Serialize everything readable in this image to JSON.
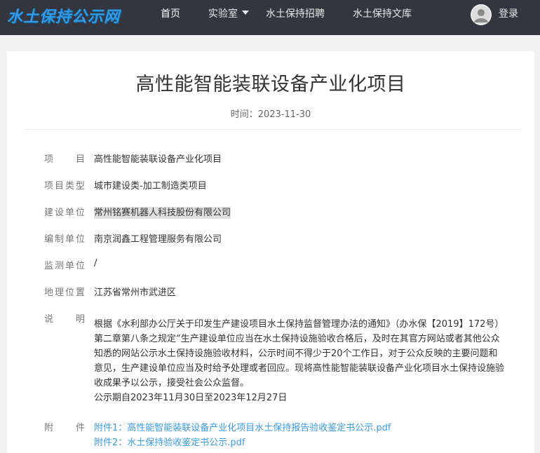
{
  "nav": {
    "logo": "水土保持公示网",
    "items": [
      "首页",
      "实验室",
      "水土保持招聘",
      "水土保持文库"
    ],
    "login": "登录",
    "icons": {
      "dropdown": "caret-down-icon",
      "avatar": "user-avatar-icon"
    },
    "colors": {
      "bar": "#33363f",
      "logo": "#2e9be8"
    }
  },
  "article": {
    "title": "高性能智能装联设备产业化项目",
    "time": "时间：2023-11-30",
    "fields": [
      {
        "label": "项目",
        "value": "高性能智能装联设备产业化项目"
      },
      {
        "label": "项目类型",
        "value": "城市建设类-加工制造类项目"
      },
      {
        "label": "建设单位",
        "value": "常州铭赛机器人科技股份有限公司"
      },
      {
        "label": "编制单位",
        "value": "南京润鑫工程管理服务有限公司"
      },
      {
        "label": "监测单位",
        "value": "/"
      },
      {
        "label": "地理位置",
        "value": "江苏省常州市武进区"
      }
    ],
    "desc_label": "说明",
    "desc": "根据《水利部办公厅关于印发生产建设项目水土保持监督管理办法的通知》（办水保【2019】172号）第二章第八条之规定“生产建设单位应当在水土保持设施验收合格后，及时在其官方网站或者其他公众知悉的网站公示水土保持设施验收材料，公示时间不得少于20个工作日，对于公众反映的主要问题和意见，生产建设单位应当及时给予处理或者回应。现将高性能智能装联设备产业化项目水土保持设施验收成果予以公示，接受社会公众监督。",
    "period": "公示期自2023年11月30日至2023年12月27日",
    "attach_label": "附件",
    "attachments": [
      "附件1：高性能智能装联设备产业化项目水土保持报告验收鉴定书公示.pdf",
      "附件2：水土保持验收鉴定书公示.pdf"
    ],
    "link_color": "#3a9be0"
  }
}
